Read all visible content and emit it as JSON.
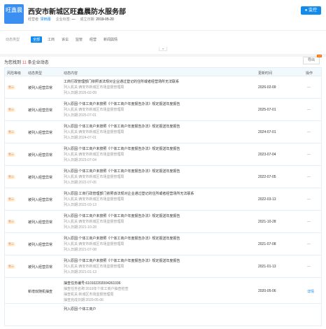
{
  "company": {
    "logo_text": "旺鑫晨",
    "name": "西安市新城区旺鑫晨防水服务部",
    "legal_rep_label": "经营者:",
    "legal_rep": "梁楠蕾",
    "status_label": "企业标签:",
    "status_value": "—",
    "found_label": "成立日期:",
    "found_date": "2019-05-20",
    "monitor_label": "监控"
  },
  "filters": {
    "label": "动态类型",
    "options": [
      "全部",
      "工商",
      "诉讼",
      "监管",
      "经营",
      "新闻舆情"
    ]
  },
  "collapse": "▾",
  "summary": {
    "prefix": "为您找到",
    "count": "11",
    "suffix": "条企业动态"
  },
  "export_label": "导出",
  "export_badge": "VIP",
  "table": {
    "headers": [
      "风险等级",
      "动态类型",
      "动态内容",
      "更新时间",
      "操作"
    ],
    "rows": [
      {
        "risk": "警示",
        "type": "被列入经营异常",
        "lines": [
          "工商行政管理部门依照该法规对企业通过登记的住所或者经营场所无法联系",
          "列入机关:西安市新城区市场监督管理局",
          "列入日期:2026-02-09"
        ],
        "date": "2026-02-09",
        "op": "—"
      },
      {
        "risk": "警示",
        "type": "被列入经营异常",
        "lines": [
          "列入原因:个体工商户未按照《个体工商户年度报告办法》规定报送年度报告",
          "列入机关:西安市新城区市场监督管理局",
          "列入日期:2025-07-01"
        ],
        "date": "2025-07-01",
        "op": "—"
      },
      {
        "risk": "警示",
        "type": "被列入经营异常",
        "lines": [
          "列入原因:个体工商户未按照《个体工商户年度报告办法》规定报送年度报告",
          "列入机关:西安市新城区市场监督管理局",
          "列入日期:2024-07-01"
        ],
        "date": "2024-07-01",
        "op": "—"
      },
      {
        "risk": "警示",
        "type": "被列入经营异常",
        "lines": [
          "列入原因:个体工商户未按照《个体工商户年度报告办法》规定报送年度报告",
          "列入机关:西安市新城区市场监督管理局",
          "列入日期:2023-07-04"
        ],
        "date": "2023-07-04",
        "op": "—"
      },
      {
        "risk": "警示",
        "type": "被列入经营异常",
        "lines": [
          "列入原因:个体工商户未按照《个体工商户年度报告办法》规定报送年度报告",
          "列入机关:西安市新城区市场监督管理局",
          "列入日期:2022-07-05"
        ],
        "date": "2022-07-05",
        "op": "—"
      },
      {
        "risk": "警示",
        "type": "被列入经营异常",
        "lines": [
          "列入原因:工商行政管理部门依照该法规对企业通过登记的住所或者经营场所无法联系",
          "列入机关:西安市新城区市场监督管理局",
          "列入日期:2022-03-13"
        ],
        "date": "2022-03-13",
        "op": "—"
      },
      {
        "risk": "警示",
        "type": "被列入经营异常",
        "lines": [
          "列入原因:个体工商户未按照《个体工商户年度报告办法》规定报送年度报告",
          "列入机关:西安市新城区市场监督管理局",
          "列入日期:2021-10-28"
        ],
        "date": "2021-10-28",
        "op": "—"
      },
      {
        "risk": "警示",
        "type": "被列入经营异常",
        "lines": [
          "列入原因:个体工商户未按照《个体工商户年度报告办法》规定报送年度报告",
          "列入机关:西安市新城区市场监督管理局",
          "列入日期:2021-07-08"
        ],
        "date": "2021-07-08",
        "op": "—"
      },
      {
        "risk": "警示",
        "type": "被列入经营异常",
        "lines": [
          "列入原因:个体工商户未按照《个体工商户年度报告办法》规定报送年度报告",
          "列入机关:西安市新城区市场监督管理局",
          "列入日期:2021-01-13"
        ],
        "date": "2021-01-13",
        "op": "—"
      },
      {
        "risk": "",
        "type": "新增双随机抽查",
        "lines": [
          "抽查任务编号:6101022020042610​36",
          "抽查任务名称:2019年个体工商户抽查检查",
          "抽查机关:新城区市场监督管理局",
          "抽查完成日期:2020-05-06"
        ],
        "date": "2020-05-06",
        "op": "详情"
      },
      {
        "risk": "",
        "type": "",
        "lines": [
          "列入原因:个体工商户"
        ],
        "date": "",
        "op": ""
      }
    ]
  }
}
